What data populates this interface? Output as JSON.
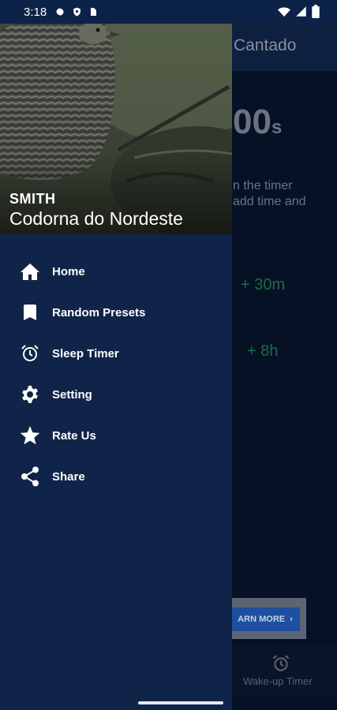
{
  "status_bar": {
    "time": "3:18"
  },
  "background": {
    "app_title": "Cantado",
    "timer_value": "00",
    "timer_unit": "s",
    "description_line1": "n the timer",
    "description_line2": "add time and",
    "add_30m": "+ 30m",
    "add_8h": "+ 8h",
    "ad_button_label": "ARN MORE",
    "bottom_nav_label": "Wake-up Timer"
  },
  "drawer": {
    "header_subtitle": "SMITH",
    "header_title": "Codorna do Nordeste",
    "menu": [
      {
        "label": "Home",
        "icon": "home-icon"
      },
      {
        "label": "Random Presets",
        "icon": "bookmark-icon"
      },
      {
        "label": "Sleep Timer",
        "icon": "alarm-clock-icon"
      },
      {
        "label": "Setting",
        "icon": "gear-icon"
      },
      {
        "label": "Rate Us",
        "icon": "star-icon"
      },
      {
        "label": "Share",
        "icon": "share-icon"
      }
    ]
  },
  "colors": {
    "drawer_bg": "#0f2448",
    "status_bar_bg": "#0d2247",
    "accent_green": "#1d6b45",
    "ad_button_blue": "#1e4fa0"
  }
}
